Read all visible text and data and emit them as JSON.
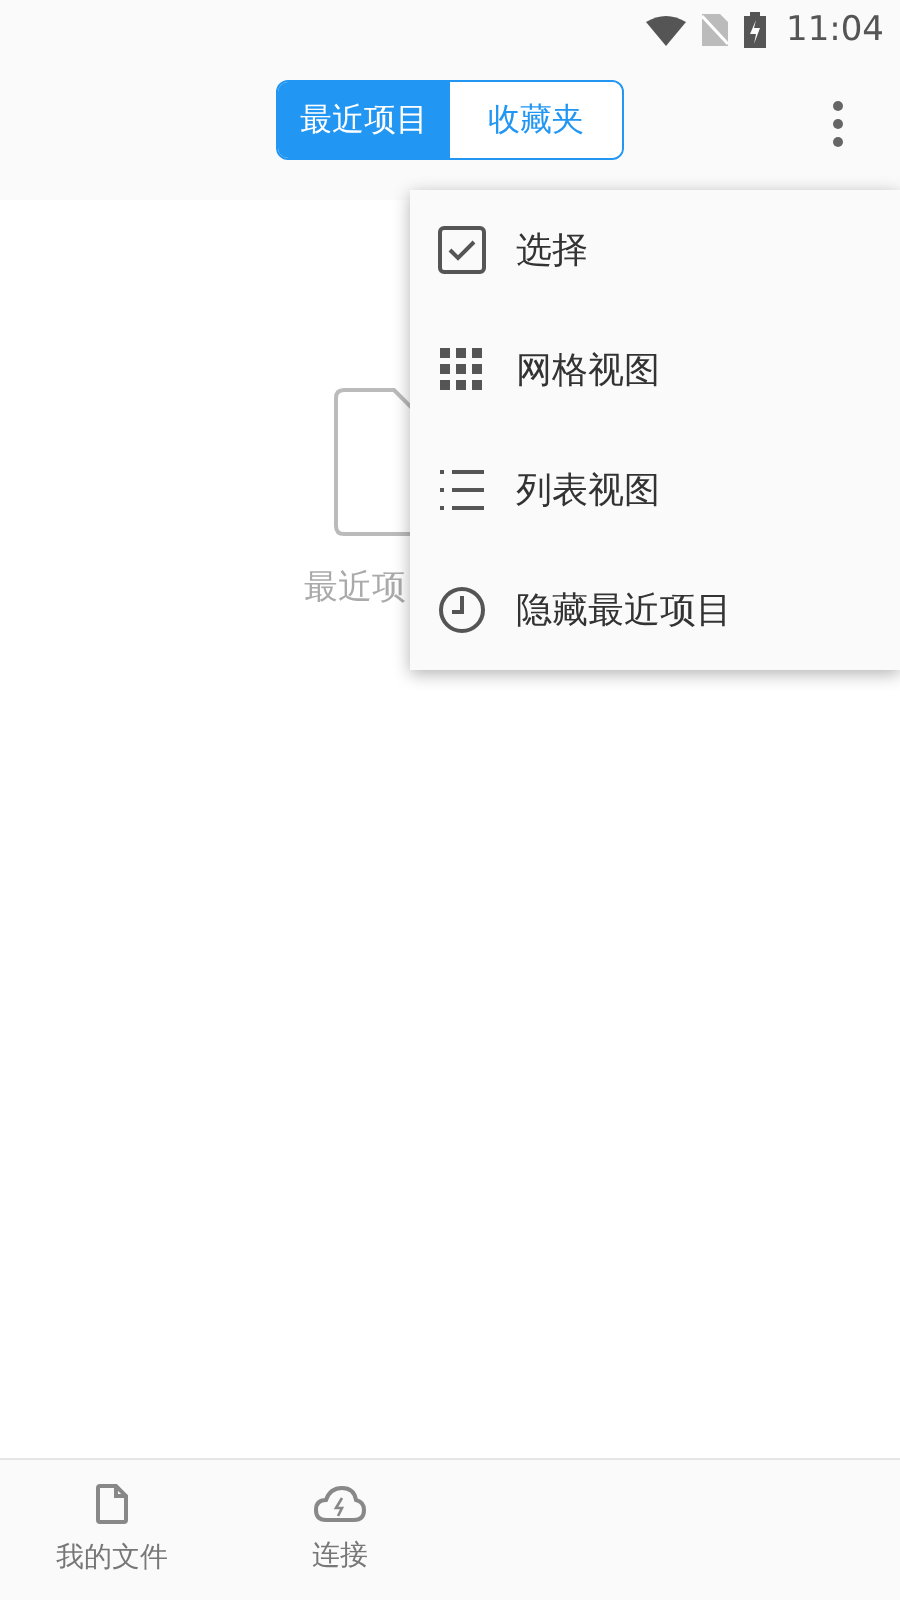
{
  "status_bar": {
    "time": "11:04"
  },
  "toolbar": {
    "tabs": [
      {
        "label": "最近项目",
        "selected": true
      },
      {
        "label": "收藏夹",
        "selected": false
      }
    ]
  },
  "empty_state": {
    "text": "最近项"
  },
  "menu": {
    "items": [
      {
        "label": "选择",
        "kind": "select"
      },
      {
        "label": "网格视图",
        "kind": "grid"
      },
      {
        "label": "列表视图",
        "kind": "list"
      },
      {
        "label": "隐藏最近项目",
        "kind": "clock"
      }
    ]
  },
  "bottom_nav": [
    {
      "label": "我的文件",
      "kind": "file"
    },
    {
      "label": "连接",
      "kind": "cloud"
    }
  ]
}
